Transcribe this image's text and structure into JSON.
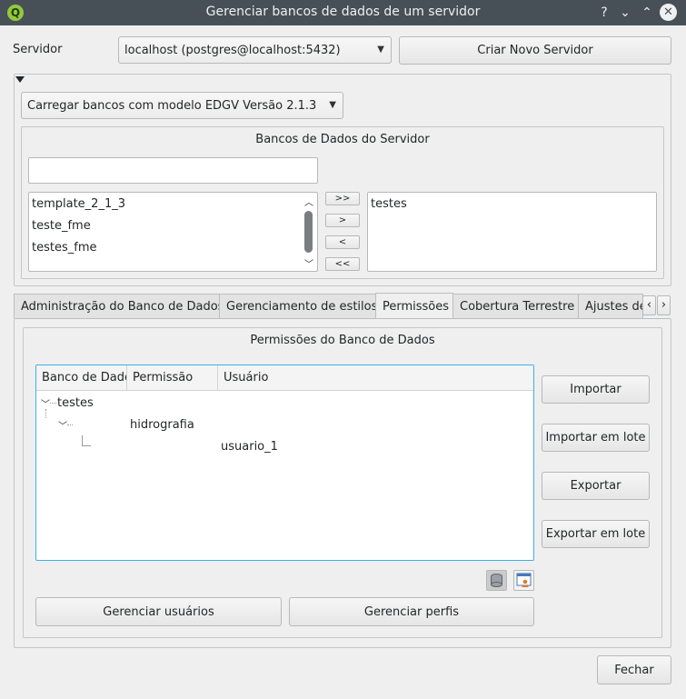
{
  "window": {
    "title": "Gerenciar bancos de dados de um servidor",
    "help": "?",
    "minimize": "⌄",
    "maximize": "⌃",
    "close": "✕"
  },
  "server": {
    "label": "Servidor",
    "selected": "localhost (postgres@localhost:5432)",
    "new_server_button": "Criar Novo Servidor"
  },
  "model_combo": {
    "selected": "Carregar bancos com modelo EDGV Versão 2.1.3"
  },
  "databases_group": {
    "title": "Bancos de Dados do Servidor",
    "filter_value": "",
    "available": [
      "template_2_1_3",
      "teste_fme",
      "testes_fme"
    ],
    "selected": [
      "testes"
    ],
    "buttons": {
      "add_all": ">>",
      "add": ">",
      "remove": "<",
      "remove_all": "<<"
    }
  },
  "tabs": [
    {
      "label": "Administração do Banco de Dados"
    },
    {
      "label": "Gerenciamento de estilos"
    },
    {
      "label": "Permissões"
    },
    {
      "label": "Cobertura Terrestre"
    },
    {
      "label": "Ajustes de"
    }
  ],
  "tab_scroll": {
    "left": "‹",
    "right": "›"
  },
  "permissions": {
    "title": "Permissões do Banco de Dados",
    "columns": [
      "Banco de Dados",
      "Permissão",
      "Usuário"
    ],
    "tree": {
      "db": "testes",
      "permission": "hidrografia",
      "user": "usuario_1"
    },
    "side_buttons": [
      "Importar",
      "Importar em lote",
      "Exportar",
      "Exportar em lote"
    ],
    "manage_users": "Gerenciar usuários",
    "manage_profiles": "Gerenciar perfis"
  },
  "close_button": "Fechar",
  "colors": {
    "titlebar": "#475057",
    "accent": "#3daee9",
    "logo": "#94c83d"
  }
}
